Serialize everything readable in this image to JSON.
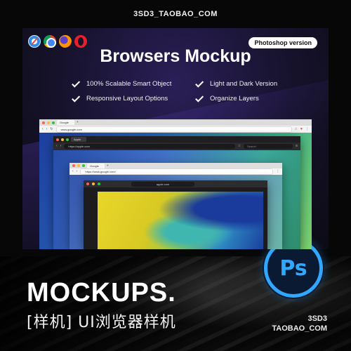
{
  "shop_tag": "3SD3_TAOBAO_COM",
  "hero": {
    "badge": "Photoshop version",
    "title": "Browsers Mockup",
    "browser_logos": [
      "safari-icon",
      "chrome-icon",
      "firefox-icon",
      "opera-icon"
    ],
    "features": [
      "100% Scalable Smart Object",
      "Light and Dark Version",
      "Responsive Layout Options",
      "Organize Layers"
    ]
  },
  "windows": {
    "outer": {
      "tab": "Google",
      "url": "www.google.com"
    },
    "dark": {
      "tab": "Apple",
      "url": "https://apple.com",
      "search_placeholder": "Search"
    },
    "inner": {
      "tab": "Google",
      "url": "https://www.google.com/"
    },
    "innermost": {
      "url": "apple.com"
    }
  },
  "banner": {
    "title": "MOCKUPS.",
    "subtitle": "[样机] UI浏览器样机",
    "ps_label": "Ps",
    "brand_line1": "3SD3",
    "brand_line2": "TAOBAO_COM"
  },
  "colors": {
    "ps_blue": "#31a8ff",
    "panel_purple": "#2a1f57"
  }
}
